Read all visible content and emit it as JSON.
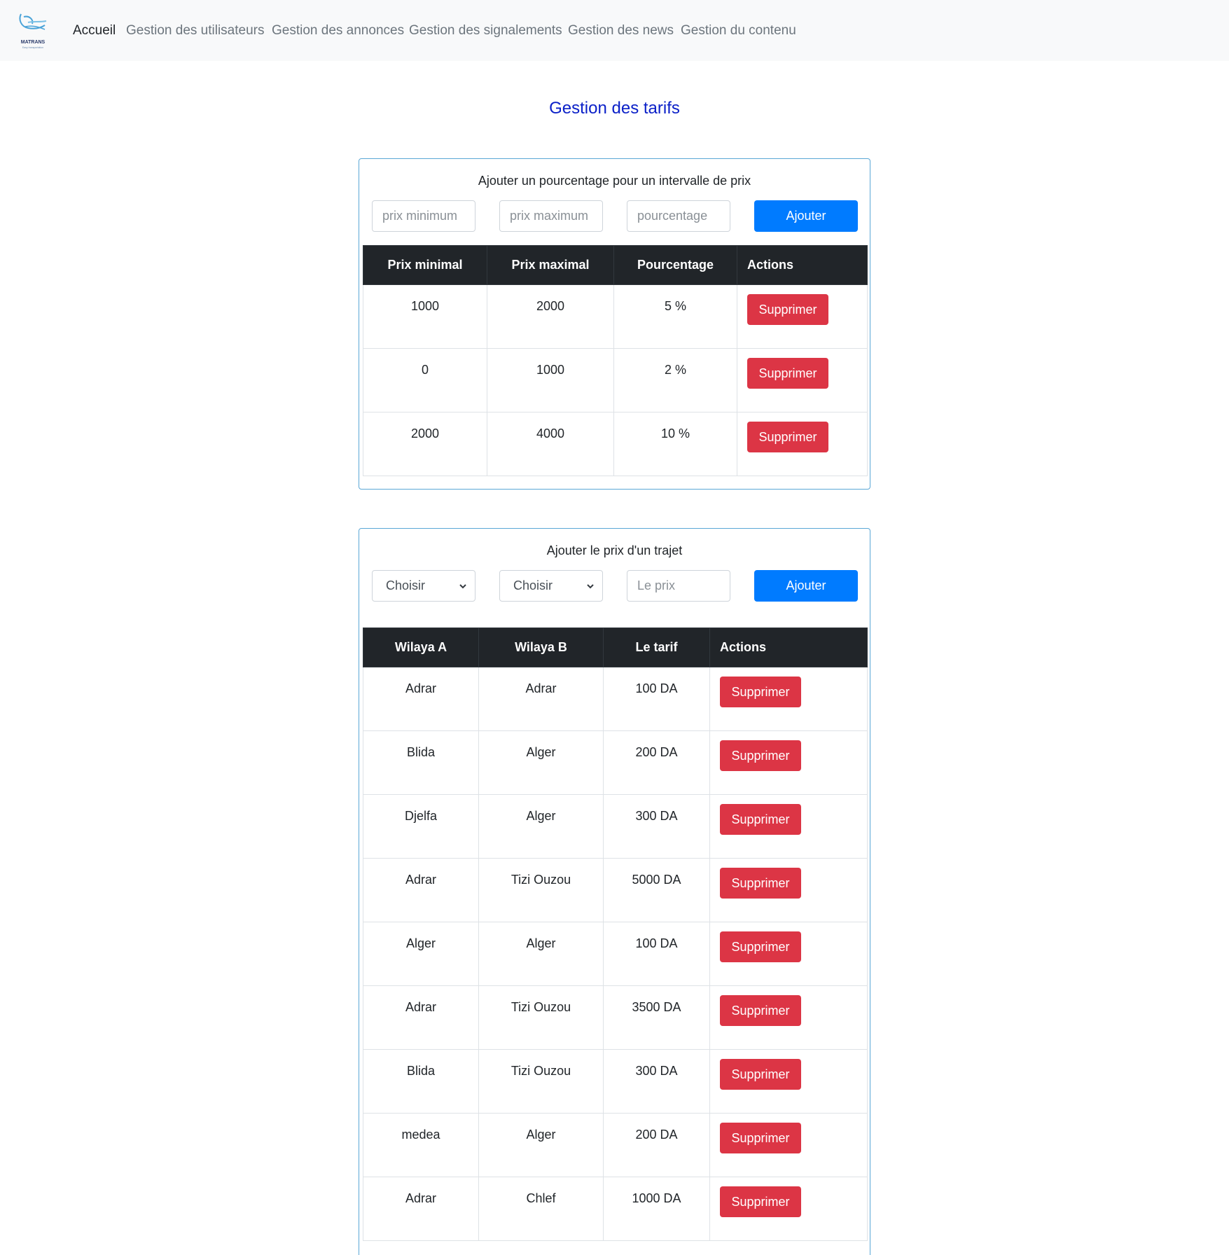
{
  "brand": {
    "logo_text": "MATRANS",
    "logo_subtext": "Easy transportation"
  },
  "nav": {
    "items": [
      {
        "label": "Accueil",
        "active": true
      },
      {
        "label": "Gestion des utilisateurs"
      },
      {
        "label": "Gestion des annonces"
      },
      {
        "label": "Gestion des signalements"
      },
      {
        "label": "Gestion des news"
      },
      {
        "label": "Gestion du contenu"
      }
    ]
  },
  "page": {
    "title": "Gestion des tarifs"
  },
  "percent_section": {
    "title": "Ajouter un pourcentage pour un intervalle de prix",
    "min_placeholder": "prix minimum",
    "max_placeholder": "prix maximum",
    "percent_placeholder": "pourcentage",
    "add_label": "Ajouter",
    "headers": [
      "Prix minimal",
      "Prix maximal",
      "Pourcentage",
      "Actions"
    ],
    "rows": [
      {
        "min": "1000",
        "max": "2000",
        "percent": "5 %",
        "action": "Supprimer"
      },
      {
        "min": "0",
        "max": "1000",
        "percent": "2 %",
        "action": "Supprimer"
      },
      {
        "min": "2000",
        "max": "4000",
        "percent": "10 %",
        "action": "Supprimer"
      }
    ]
  },
  "route_section": {
    "title": "Ajouter le prix d'un trajet",
    "select_a": "Choisir",
    "select_b": "Choisir",
    "price_placeholder": "Le prix",
    "add_label": "Ajouter",
    "headers": [
      "Wilaya A",
      "Wilaya B",
      "Le tarif",
      "Actions"
    ],
    "rows": [
      {
        "a": "Adrar",
        "b": "Adrar",
        "tarif": "100 DA",
        "action": "Supprimer"
      },
      {
        "a": "Blida",
        "b": "Alger",
        "tarif": "200 DA",
        "action": "Supprimer"
      },
      {
        "a": "Djelfa",
        "b": "Alger",
        "tarif": "300 DA",
        "action": "Supprimer"
      },
      {
        "a": "Adrar",
        "b": "Tizi Ouzou",
        "tarif": "5000 DA",
        "action": "Supprimer"
      },
      {
        "a": "Alger",
        "b": "Alger",
        "tarif": "100 DA",
        "action": "Supprimer"
      },
      {
        "a": "Adrar",
        "b": "Tizi Ouzou",
        "tarif": "3500 DA",
        "action": "Supprimer"
      },
      {
        "a": "Blida",
        "b": "Tizi Ouzou",
        "tarif": "300 DA",
        "action": "Supprimer"
      },
      {
        "a": "medea",
        "b": "Alger",
        "tarif": "200 DA",
        "action": "Supprimer"
      },
      {
        "a": "Adrar",
        "b": "Chlef",
        "tarif": "1000 DA",
        "action": "Supprimer"
      }
    ]
  }
}
